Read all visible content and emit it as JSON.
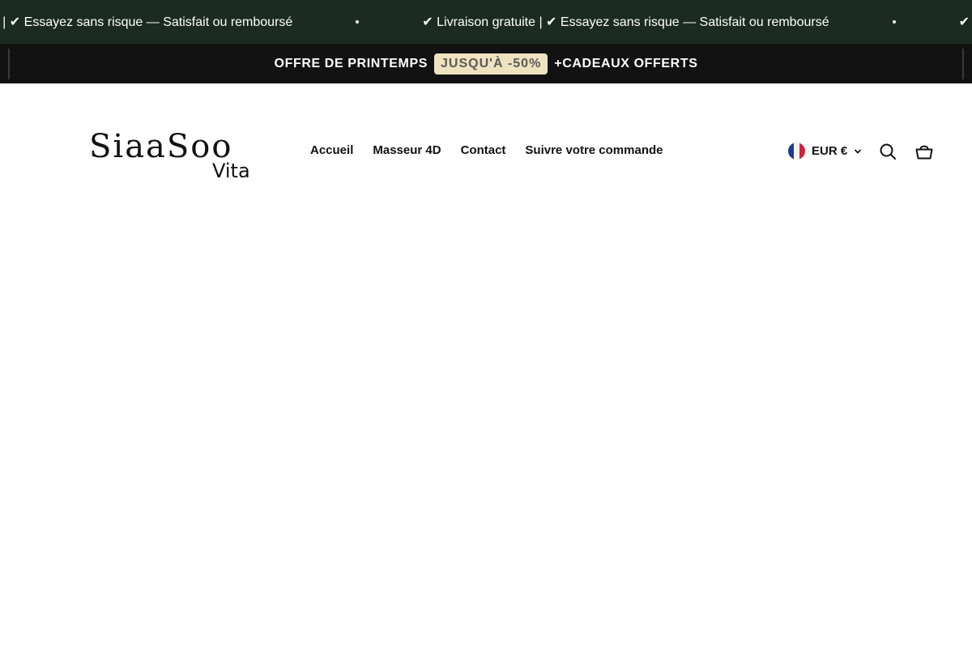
{
  "announcement": {
    "items": [
      "✔ Livraison gratuite | ✔ Essayez sans risque — Satisfait ou remboursé",
      "✔ Livraison gratuite | ✔ Essayez sans risque — Satisfait ou remboursé",
      "✔ Livraison gratuite | ✔ Essayez sans risque — Satisfait ou remboursé"
    ],
    "background": "#1c2b22"
  },
  "promo": {
    "lead": "OFFRE DE PRINTEMPS",
    "badge": "JUSQU'À -50%",
    "tail": "+CADEAUX OFFERTS",
    "badge_color": "#efe2bf"
  },
  "header": {
    "logo_main": "SiaaSoo",
    "logo_sub": "Vita",
    "nav": [
      "Accueil",
      "Masseur 4D",
      "Contact",
      "Suivre votre commande"
    ],
    "currency": "EUR €",
    "currency_flag": "france-flag-icon",
    "icons": [
      "search-icon",
      "cart-icon"
    ]
  }
}
